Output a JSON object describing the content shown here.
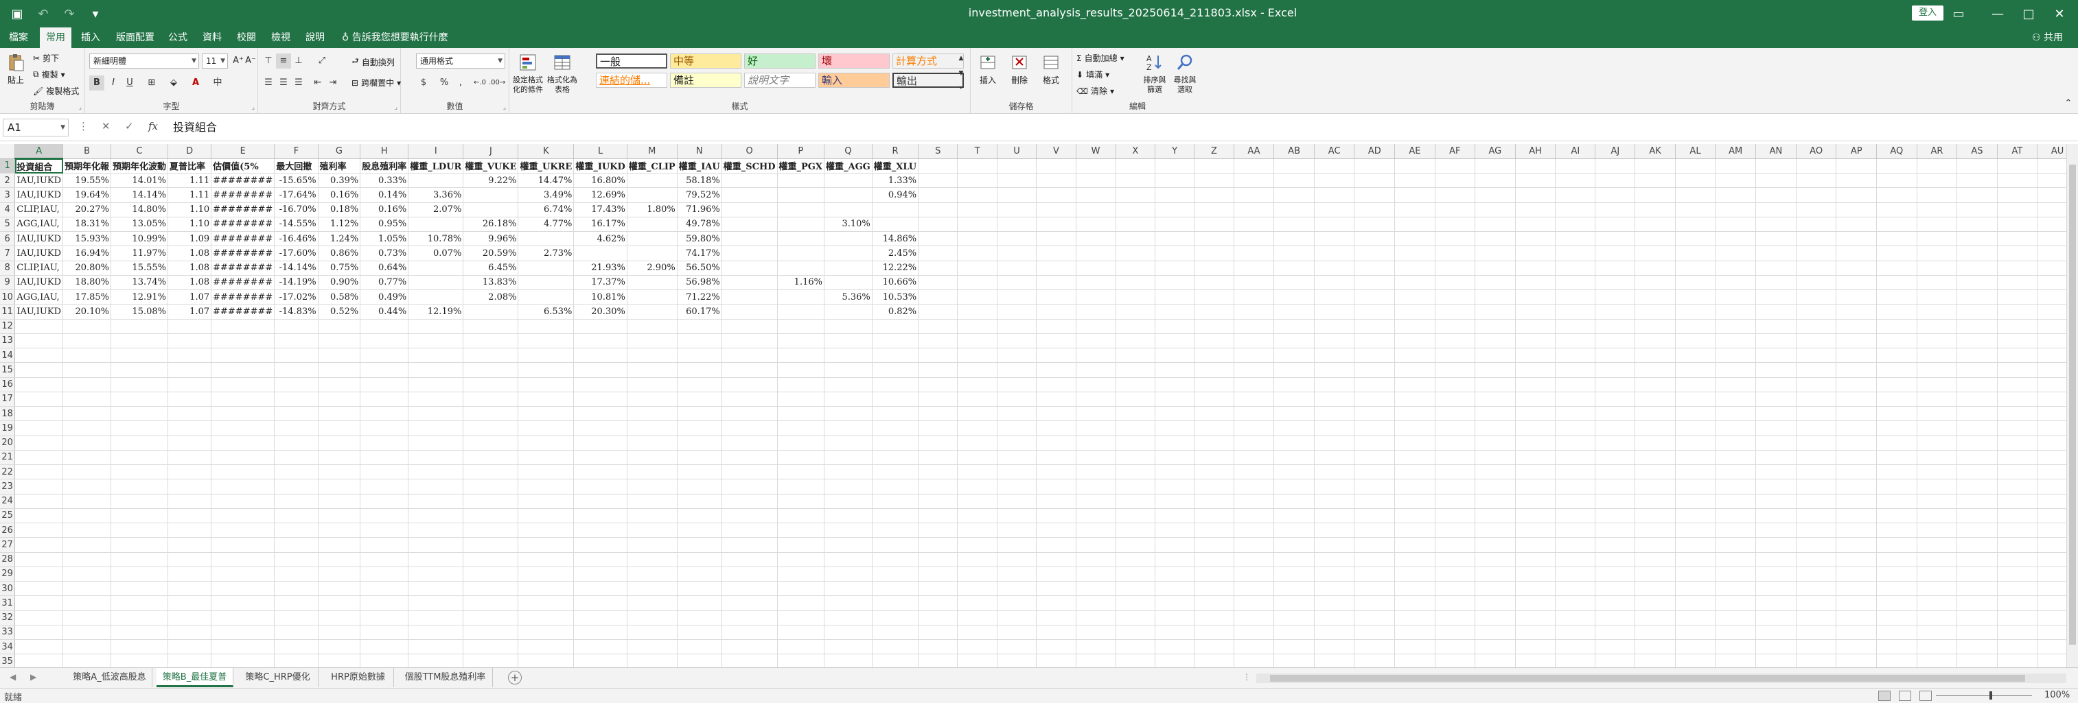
{
  "app": {
    "title": "investment_analysis_results_20250614_211803.xlsx - Excel",
    "signin": "登入",
    "share": "共用"
  },
  "menu": {
    "tabs": [
      "檔案",
      "常用",
      "插入",
      "版面配置",
      "公式",
      "資料",
      "校閱",
      "檢視",
      "說明"
    ],
    "active_index": 1,
    "tellme": "告訴我您想要執行什麼"
  },
  "ribbon": {
    "clipboard": {
      "label": "剪貼簿",
      "paste": "貼上",
      "cut": "剪下",
      "copy": "複製",
      "format_painter": "複製格式"
    },
    "font": {
      "label": "字型",
      "name": "新細明體",
      "size": "11",
      "bold": "B",
      "italic": "I",
      "underline": "U"
    },
    "alignment": {
      "label": "對齊方式",
      "wrap_text": "自動換列",
      "merge_center": "跨欄置中"
    },
    "number": {
      "label": "數值",
      "format": "通用格式",
      "currency": "$",
      "percent": "%",
      "comma": ","
    },
    "styles": {
      "label": "樣式",
      "conditional_formatting": "設定格式化的條件",
      "format_as_table": "格式化為表格",
      "cells": [
        {
          "text": "一般",
          "bg": "#ffffff",
          "fg": "#222222"
        },
        {
          "text": "中等",
          "bg": "#ffeb9c",
          "fg": "#9c5700"
        },
        {
          "text": "好",
          "bg": "#c6efce",
          "fg": "#006100"
        },
        {
          "text": "壞",
          "bg": "#ffc7ce",
          "fg": "#9c0006"
        },
        {
          "text": "計算方式",
          "bg": "#f2f2f2",
          "fg": "#fa7d00"
        },
        {
          "text": "連結的儲...",
          "bg": "#ffffff",
          "fg": "#fa7d00"
        },
        {
          "text": "備註",
          "bg": "#ffffcc",
          "fg": "#222222"
        },
        {
          "text": "說明文字",
          "bg": "#ffffff",
          "fg": "#7f7f7f"
        },
        {
          "text": "輸入",
          "bg": "#ffcc99",
          "fg": "#3f3f76"
        },
        {
          "text": "輸出",
          "bg": "#f2f2f2",
          "fg": "#3f3f3f"
        }
      ]
    },
    "cells_group": {
      "label": "儲存格",
      "insert": "插入",
      "delete": "刪除",
      "format": "格式"
    },
    "editing": {
      "label": "編輯",
      "autosum": "自動加總",
      "fill": "填滿",
      "clear": "清除",
      "sort_filter": "排序與篩選",
      "find_select": "尋找與選取"
    }
  },
  "formula_bar": {
    "name_box": "A1",
    "content": "投資組合"
  },
  "grid": {
    "columns": [
      "A",
      "B",
      "C",
      "D",
      "E",
      "F",
      "G",
      "H",
      "I",
      "J",
      "K",
      "L",
      "M",
      "N",
      "O",
      "P",
      "Q",
      "R",
      "S",
      "T",
      "U",
      "V",
      "W",
      "X",
      "Y",
      "Z",
      "AA",
      "AB",
      "AC",
      "AD",
      "AE",
      "AF",
      "AG",
      "AH",
      "AI",
      "AJ",
      "AK",
      "AL",
      "AM",
      "AN",
      "AO",
      "AP",
      "AQ",
      "AR",
      "AS",
      "AT",
      "AU"
    ],
    "header_row": [
      "投資組合",
      "預期年化報",
      "預期年化波動",
      "夏普比率",
      "估價值(5%",
      "最大回撤",
      "殖利率",
      "股息殖利率",
      "權重_LDUR",
      "權重_VUKE",
      "權重_UKRE",
      "權重_IUKD",
      "權重_CLIP",
      "權重_IAU",
      "權重_SCHD",
      "權重_PGX",
      "權重_AGG",
      "權重_XLU"
    ],
    "rows": [
      [
        "IAU,IUKD",
        "19.55%",
        "14.01%",
        "1.11",
        "########",
        "-15.65%",
        "0.39%",
        "0.33%",
        "",
        "9.22%",
        "14.47%",
        "16.80%",
        "",
        "58.18%",
        "",
        "",
        "",
        "1.33%"
      ],
      [
        "IAU,IUKD",
        "19.64%",
        "14.14%",
        "1.11",
        "########",
        "-17.64%",
        "0.16%",
        "0.14%",
        "3.36%",
        "",
        "3.49%",
        "12.69%",
        "",
        "79.52%",
        "",
        "",
        "",
        "0.94%"
      ],
      [
        "CLIP,IAU,",
        "20.27%",
        "14.80%",
        "1.10",
        "########",
        "-16.70%",
        "0.18%",
        "0.16%",
        "2.07%",
        "",
        "6.74%",
        "17.43%",
        "1.80%",
        "71.96%",
        "",
        "",
        "",
        ""
      ],
      [
        "AGG,IAU,",
        "18.31%",
        "13.05%",
        "1.10",
        "########",
        "-14.55%",
        "1.12%",
        "0.95%",
        "",
        "26.18%",
        "4.77%",
        "16.17%",
        "",
        "49.78%",
        "",
        "",
        "3.10%",
        ""
      ],
      [
        "IAU,IUKD",
        "15.93%",
        "10.99%",
        "1.09",
        "########",
        "-16.46%",
        "1.24%",
        "1.05%",
        "10.78%",
        "9.96%",
        "",
        "4.62%",
        "",
        "59.80%",
        "",
        "",
        "",
        "14.86%"
      ],
      [
        "IAU,IUKD",
        "16.94%",
        "11.97%",
        "1.08",
        "########",
        "-17.60%",
        "0.86%",
        "0.73%",
        "0.07%",
        "20.59%",
        "2.73%",
        "",
        "",
        "74.17%",
        "",
        "",
        "",
        "2.45%"
      ],
      [
        "CLIP,IAU,",
        "20.80%",
        "15.55%",
        "1.08",
        "########",
        "-14.14%",
        "0.75%",
        "0.64%",
        "",
        "6.45%",
        "",
        "21.93%",
        "2.90%",
        "56.50%",
        "",
        "",
        "",
        "12.22%"
      ],
      [
        "IAU,IUKD",
        "18.80%",
        "13.74%",
        "1.08",
        "########",
        "-14.19%",
        "0.90%",
        "0.77%",
        "",
        "13.83%",
        "",
        "17.37%",
        "",
        "56.98%",
        "",
        "1.16%",
        "",
        "10.66%"
      ],
      [
        "AGG,IAU,",
        "17.85%",
        "12.91%",
        "1.07",
        "########",
        "-17.02%",
        "0.58%",
        "0.49%",
        "",
        "2.08%",
        "",
        "10.81%",
        "",
        "71.22%",
        "",
        "",
        "5.36%",
        "10.53%"
      ],
      [
        "IAU,IUKD",
        "20.10%",
        "15.08%",
        "1.07",
        "########",
        "-14.83%",
        "0.52%",
        "0.44%",
        "12.19%",
        "",
        "6.53%",
        "20.30%",
        "",
        "60.17%",
        "",
        "",
        "",
        "0.82%"
      ]
    ],
    "total_rows": 36
  },
  "sheet_tabs": {
    "tabs": [
      "策略A_低波高股息",
      "策略B_最佳夏普",
      "策略C_HRP優化",
      "HRP原始數據",
      "個股TTM股息殖利率"
    ],
    "active_index": 1
  },
  "status": {
    "ready": "就緒",
    "zoom": "100%"
  },
  "colors": {
    "brand": "#217346"
  }
}
